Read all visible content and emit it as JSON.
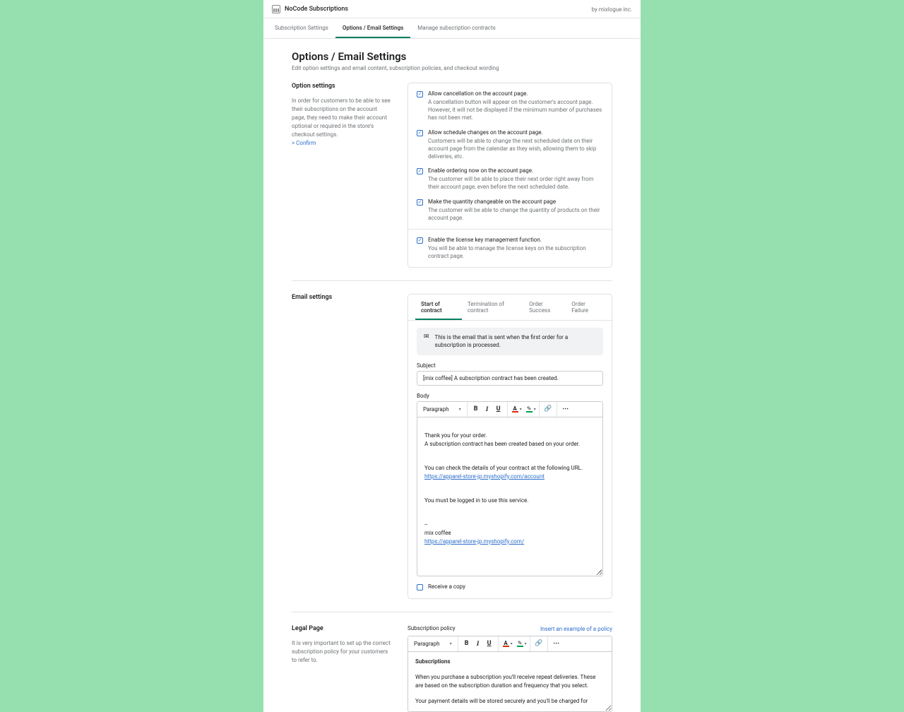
{
  "header": {
    "app_title": "NoCode Subscriptions",
    "attribution": "by mixlogue inc."
  },
  "tabs": [
    {
      "label": "Subscription Settings"
    },
    {
      "label": "Options / Email Settings"
    },
    {
      "label": "Manage subscription contracts"
    }
  ],
  "page": {
    "title": "Options / Email Settings",
    "subtitle": "Edit option settings and email content, subscription policies, and checkout wording"
  },
  "option_settings": {
    "title": "Option settings",
    "desc": "In order for customers to be able to see their subscriptions on the account page, they need to make their account optional or required in the store's checkout settings.",
    "confirm_link": "> Confirm",
    "options": [
      {
        "label": "Allow cancellation on the account page.",
        "help": "A cancellation button will appear on the customer's account page. However, it will not be displayed if the minimum number of purchases has not been met."
      },
      {
        "label": "Allow schedule changes on the account page.",
        "help": "Customers will be able to change the next scheduled date on their account page from the calendar as they wish, allowing them to skip deliveries, etc."
      },
      {
        "label": "Enable ordering now on the account page.",
        "help": "The customer will be able to place their next order right away from their account page, even before the next scheduled date."
      },
      {
        "label": "Make the quantity changeable on the account page",
        "help": "The customer will be able to change the quantity of products on their account page."
      }
    ],
    "license": {
      "label": "Enable the license key management function.",
      "help": "You will be able to manage the license keys on the subscription contract page."
    }
  },
  "email_settings": {
    "title": "Email settings",
    "subtabs": [
      {
        "label": "Start of contract"
      },
      {
        "label": "Termination of contract"
      },
      {
        "label": "Order Success"
      },
      {
        "label": "Order Failure"
      }
    ],
    "info": "This is the email that is sent when the first order for a subscription is processed.",
    "subject_label": "Subject",
    "subject_value": "[mix coffee] A subscription contract has been created.",
    "body_label": "Body",
    "paragraph_label": "Paragraph",
    "body": {
      "p1": "Thank you for your order.\nA subscription contract has been created based on your order.",
      "p2": "You can check the details of your contract at the following URL.",
      "link1": "https://apparel-store-jp.myshopify.com/account",
      "p3": "You must be logged in to use this service.",
      "sig1": "--",
      "sig2": "mix coffee",
      "link2": "https://apparel-store-jp.myshopify.com/"
    },
    "receive_copy": "Receive a copy"
  },
  "legal": {
    "title": "Legal Page",
    "desc": "It is very important to set up the correct subscription policy for your customers to refer to.",
    "policy_label": "Subscription policy",
    "insert_link": "Insert an example of a policy",
    "paragraph_label": "Paragraph",
    "body": {
      "h": "Subscriptions",
      "p1": "When you purchase a subscription you'll receive repeat deliveries. These are based on the subscription duration and frequency that you select.",
      "p2": "Your payment details will be stored securely and you'll be charged for"
    }
  }
}
